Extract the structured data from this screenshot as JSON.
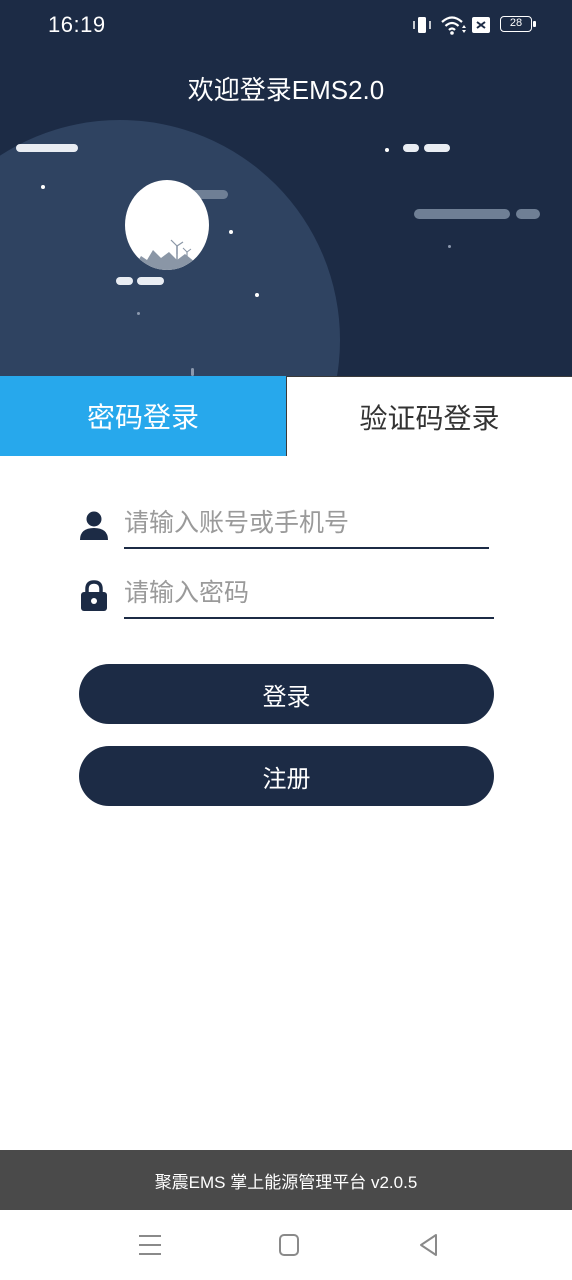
{
  "status_bar": {
    "time": "16:19",
    "battery": "28"
  },
  "header": {
    "title": "欢迎登录EMS2.0"
  },
  "tabs": [
    {
      "label": "密码登录",
      "active": true
    },
    {
      "label": "验证码登录",
      "active": false
    }
  ],
  "form": {
    "account_placeholder": "请输入账号或手机号",
    "password_placeholder": "请输入密码",
    "login_label": "登录",
    "register_label": "注册"
  },
  "footer": {
    "text": "聚震EMS 掌上能源管理平台 v2.0.5"
  },
  "colors": {
    "primary": "#1c2b45",
    "accent_tab": "#27a8ec",
    "footer_bg": "#4a4a4a"
  },
  "icons": [
    "vibrate-icon",
    "wifi-icon",
    "sim-off-icon",
    "battery-icon",
    "user-icon",
    "lock-icon",
    "menu-icon",
    "home-icon",
    "back-icon"
  ]
}
